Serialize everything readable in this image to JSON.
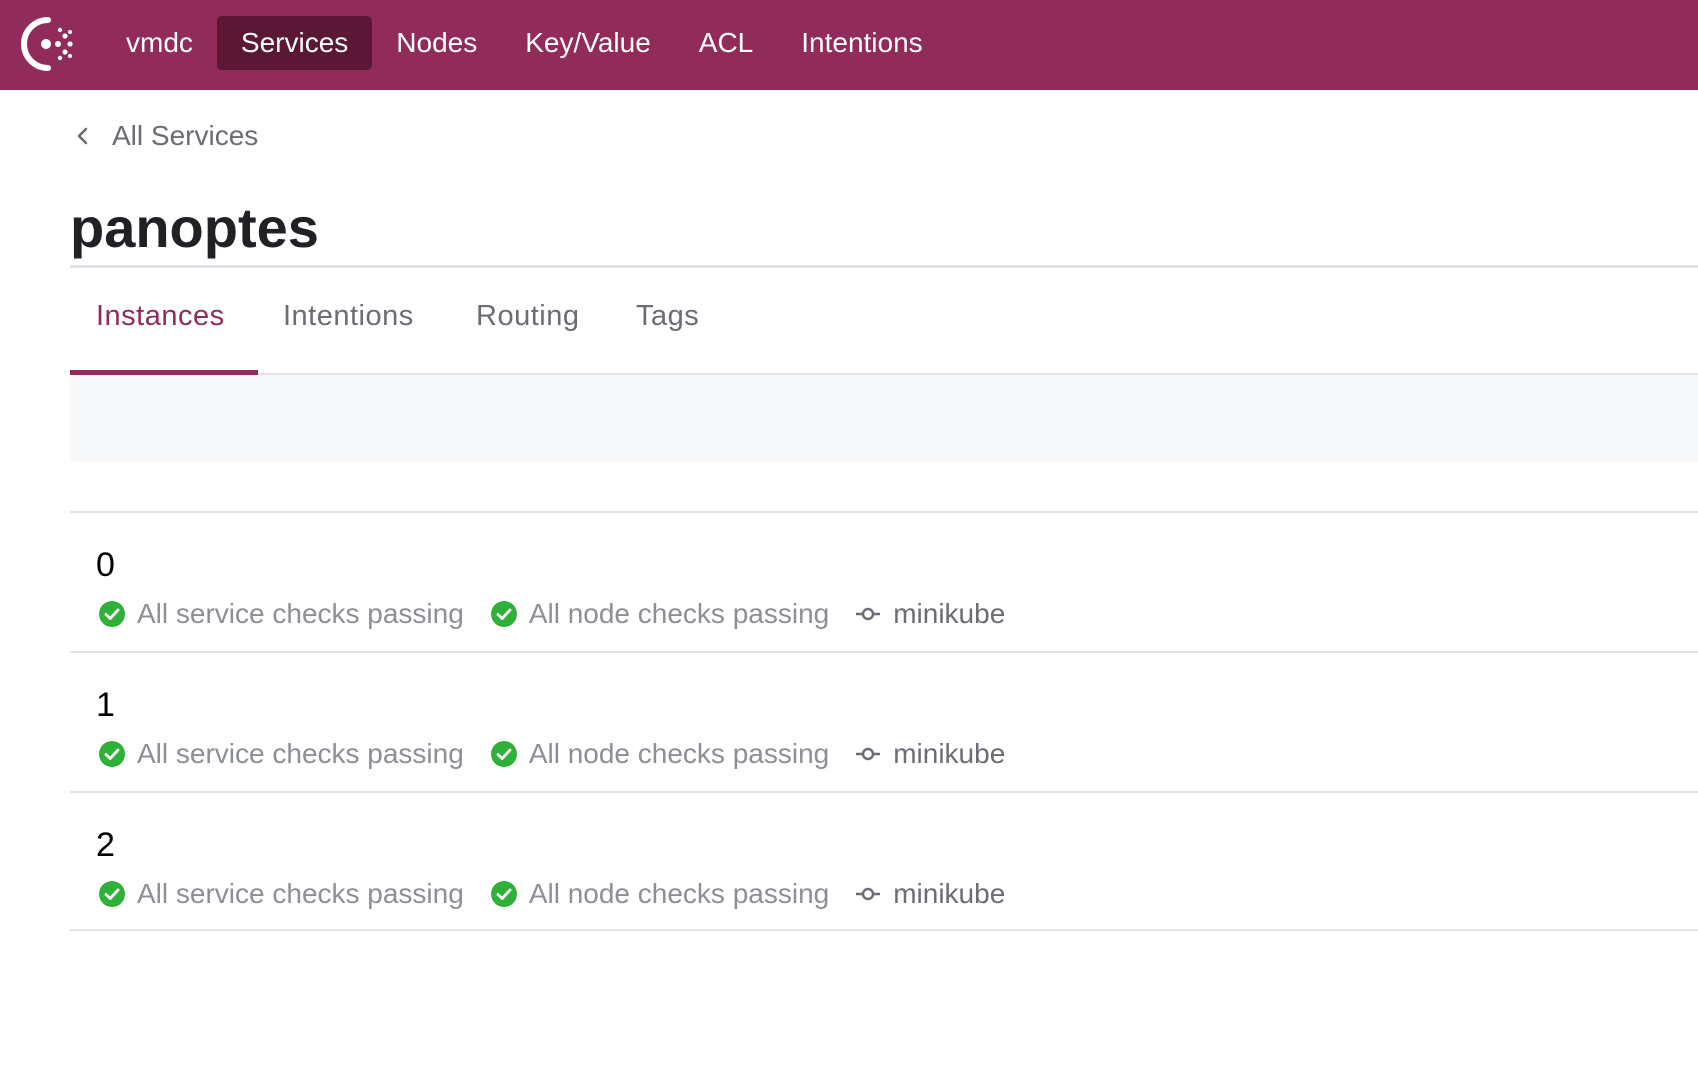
{
  "nav": {
    "datacenter": "vmdc",
    "items": [
      {
        "label": "Services",
        "active": true
      },
      {
        "label": "Nodes",
        "active": false
      },
      {
        "label": "Key/Value",
        "active": false
      },
      {
        "label": "ACL",
        "active": false
      },
      {
        "label": "Intentions",
        "active": false
      }
    ]
  },
  "breadcrumb": {
    "label": "All Services",
    "icon": "chevron-left-icon"
  },
  "service": {
    "name": "panoptes"
  },
  "tabs": [
    {
      "label": "Instances",
      "active": true
    },
    {
      "label": "Intentions",
      "active": false
    },
    {
      "label": "Routing",
      "active": false
    },
    {
      "label": "Tags",
      "active": false
    }
  ],
  "instances": [
    {
      "name": "0",
      "service_checks": "All service checks passing",
      "node_checks": "All node checks passing",
      "node": "minikube"
    },
    {
      "name": "1",
      "service_checks": "All service checks passing",
      "node_checks": "All node checks passing",
      "node": "minikube"
    },
    {
      "name": "2",
      "service_checks": "All service checks passing",
      "node_checks": "All node checks passing",
      "node": "minikube"
    }
  ],
  "colors": {
    "brand": "#912b5a",
    "nav_active": "#5a1835",
    "passing": "#2eb039",
    "muted_text": "#8c8f96"
  }
}
